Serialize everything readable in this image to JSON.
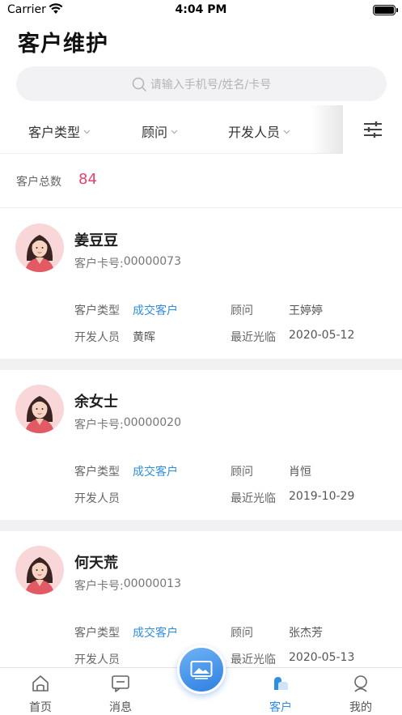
{
  "status_bar": {
    "carrier": "Carrier",
    "time": "4:04 PM"
  },
  "page": {
    "title": "客户维护"
  },
  "search": {
    "placeholder": "请输入手机号/姓名/卡号"
  },
  "filters": [
    {
      "label": "客户类型"
    },
    {
      "label": "顾问"
    },
    {
      "label": "开发人员"
    }
  ],
  "summary": {
    "label": "客户总数",
    "count": "84"
  },
  "field_labels": {
    "card_prefix": "客户卡号: ",
    "type": "客户类型",
    "advisor": "顾问",
    "developer": "开发人员",
    "last_visit": "最近光临"
  },
  "customers": [
    {
      "name": "姜豆豆",
      "card_no": "00000073",
      "type": "成交客户",
      "advisor": "王婷婷",
      "developer": "黄晖",
      "last_visit": "2020-05-12"
    },
    {
      "name": "余女士",
      "card_no": "00000020",
      "type": "成交客户",
      "advisor": "肖恒",
      "developer": "",
      "last_visit": "2019-10-29"
    },
    {
      "name": "何天荒",
      "card_no": "00000013",
      "type": "成交客户",
      "advisor": "张杰芳",
      "developer": "",
      "last_visit": "2020-05-13"
    }
  ],
  "tabbar": {
    "items": [
      {
        "label": "首页",
        "icon": "home-icon"
      },
      {
        "label": "消息",
        "icon": "message-icon"
      },
      {
        "label": "客户",
        "icon": "customer-icon",
        "active": true
      },
      {
        "label": "我的",
        "icon": "profile-icon"
      }
    ],
    "center_icon": "image-icon"
  },
  "colors": {
    "accent": "#2f8ee0",
    "count": "#e2436b",
    "separator": "#f1f1f3"
  }
}
